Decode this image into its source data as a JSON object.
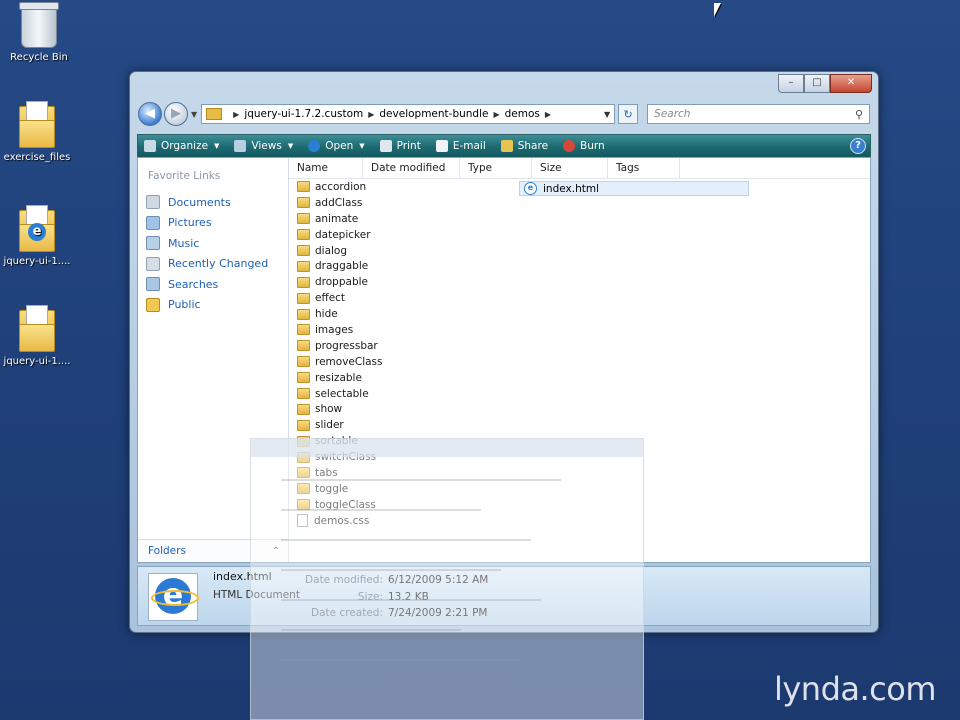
{
  "desktop": {
    "icons": [
      {
        "label": "Recycle Bin",
        "icon": "recycle-bin-icon"
      },
      {
        "label": "exercise_files",
        "icon": "folder-icon"
      },
      {
        "label": "jquery-ui-1....",
        "icon": "ie-document-folder-icon"
      },
      {
        "label": "jquery-ui-1....",
        "icon": "folder-icon"
      }
    ]
  },
  "window": {
    "address": {
      "crumbs": [
        "jquery-ui-1.7.2.custom",
        "development-bundle",
        "demos"
      ]
    },
    "search": {
      "placeholder": "Search"
    },
    "toolbar": {
      "items": [
        "Organize",
        "Views",
        "Open",
        "Print",
        "E-mail",
        "Share",
        "Burn"
      ]
    },
    "navpane": {
      "header": "Favorite Links",
      "links": [
        "Documents",
        "Pictures",
        "Music",
        "Recently Changed",
        "Searches",
        "Public"
      ],
      "folders_label": "Folders"
    },
    "columns": [
      "Name",
      "Date modified",
      "Type",
      "Size",
      "Tags"
    ],
    "folders": [
      "accordion",
      "addClass",
      "animate",
      "datepicker",
      "dialog",
      "draggable",
      "droppable",
      "effect",
      "hide",
      "images",
      "progressbar",
      "removeClass",
      "resizable",
      "selectable",
      "show",
      "slider",
      "sortable",
      "switchClass",
      "tabs",
      "toggle",
      "toggleClass"
    ],
    "files": [
      "demos.css"
    ],
    "selected_file": "index.html",
    "details": {
      "name": "index.html",
      "type": "HTML Document",
      "date_modified_label": "Date modified:",
      "date_modified": "6/12/2009 5:12 AM",
      "size_label": "Size:",
      "size": "13.2 KB",
      "date_created_label": "Date created:",
      "date_created": "7/24/2009 2:21 PM"
    }
  },
  "watermark": "lynda.com",
  "colors": {
    "desktop": "#254a86",
    "toolbar": "#1f6c74",
    "link": "#1e5eb5"
  }
}
